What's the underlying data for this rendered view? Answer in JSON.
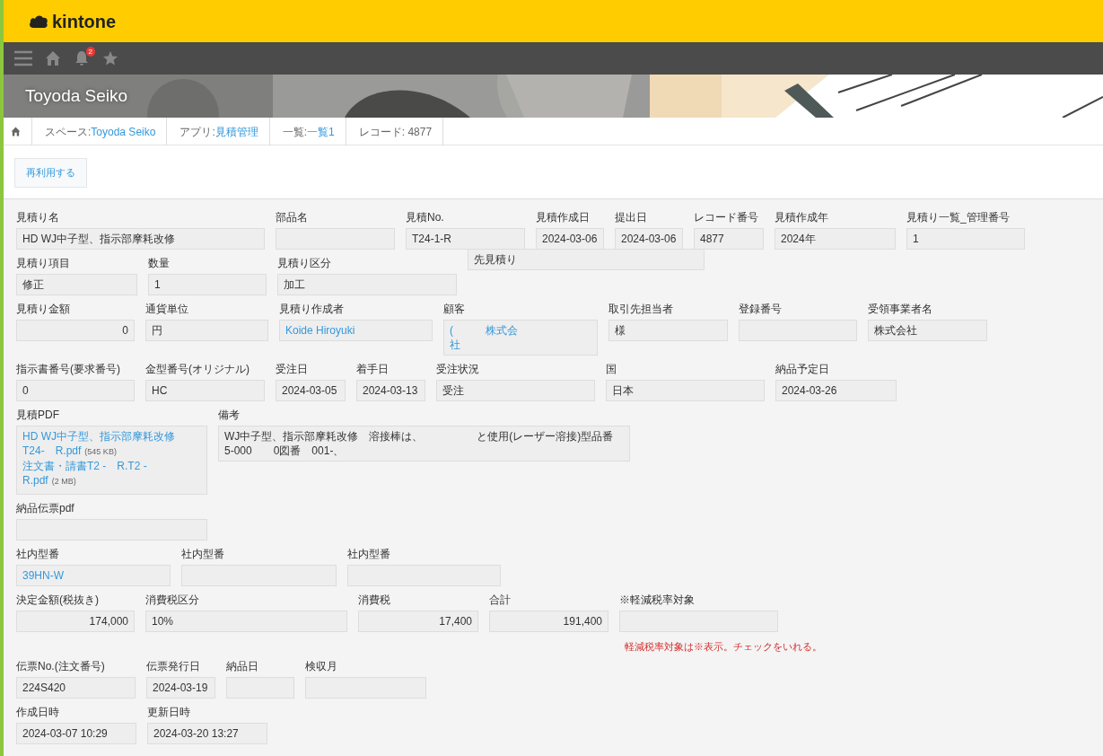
{
  "header": {
    "logo": "kintone"
  },
  "toolbar": {
    "notification_count": "2"
  },
  "banner": {
    "title": "Toyoda Seiko"
  },
  "breadcrumb": [
    {
      "prefix": "スペース: ",
      "link": "Toyoda Seiko"
    },
    {
      "prefix": "アプリ: ",
      "link": "見積管理"
    },
    {
      "prefix": "一覧: ",
      "link": "一覧1"
    },
    {
      "prefix": "レコード: 4877"
    }
  ],
  "actions": [
    {
      "label": "再利用する"
    }
  ],
  "form_rows": [
    {
      "fields": [
        {
          "label": "見積り名",
          "kind": "text",
          "value": "HD WJ中子型、指示部摩耗改修"
        },
        {
          "label": "部品名",
          "kind": "text"
        },
        {
          "label": "見積No.",
          "kind": "text",
          "value": "T24-1-R"
        },
        {
          "label": "見積作成日",
          "kind": "text",
          "value": "2024-03-06"
        },
        {
          "label": "提出日",
          "kind": "text",
          "value": "2024-03-06"
        },
        {
          "label": "レコード番号",
          "kind": "text",
          "value": "4877"
        },
        {
          "label": "見積作成年",
          "kind": "text",
          "value": "2024年"
        },
        {
          "label": "見積り一覧_管理番号",
          "kind": "text",
          "value": "1"
        }
      ]
    },
    {
      "fields": [
        {
          "label": "見積り項目",
          "kind": "text",
          "value": "修正"
        },
        {
          "label": "数量",
          "kind": "text",
          "value": "1"
        },
        {
          "label": "見積り区分",
          "kind": "text",
          "value": "加工"
        },
        {
          "kind": "text",
          "value": "先見積り"
        }
      ]
    },
    {
      "fields": [
        {
          "label": "見積り金額",
          "kind": "number",
          "value": "0"
        },
        {
          "label": "通貨単位",
          "kind": "text",
          "value": "円"
        },
        {
          "label": "見積り作成者",
          "kind": "link",
          "value": "Koide Hiroyuki"
        },
        {
          "label": "顧客",
          "kind": "link",
          "lines": [
            "(　　　株式会",
            "社"
          ]
        },
        {
          "label": "取引先担当者",
          "kind": "text",
          "value": "様"
        },
        {
          "label": "登録番号",
          "kind": "text"
        },
        {
          "label": "受領事業者名",
          "kind": "text",
          "value": "株式会社"
        }
      ]
    },
    {
      "fields": [
        {
          "label": "指示書番号(要求番号)",
          "kind": "text",
          "value": "0"
        },
        {
          "label": "金型番号(オリジナル)",
          "kind": "text",
          "value": "HC"
        },
        {
          "label": "受注日",
          "kind": "text",
          "value": "2024-03-05"
        },
        {
          "label": "着手日",
          "kind": "text",
          "value": "2024-03-13"
        },
        {
          "label": "受注状況",
          "kind": "text",
          "value": "受注"
        },
        {
          "label": "国",
          "kind": "text",
          "value": "日本"
        },
        {
          "label": "納品予定日",
          "kind": "text",
          "value": "2024-03-26"
        }
      ]
    },
    {
      "fields": [
        {
          "label": "見積PDF",
          "kind": "files",
          "files": [
            {
              "name_lines": [
                "HD WJ中子型、指示部摩耗改修",
                "T24-　R.pdf"
              ],
              "size": "(545 KB)"
            },
            {
              "name_lines": [
                "注文書・請書T2 -　R.T2 -",
                "R.pdf"
              ],
              "size": "(2 MB)"
            }
          ]
        },
        {
          "label": "備考",
          "kind": "multiline",
          "value": "WJ中子型、指示部摩耗改修　溶接棒は、　　　　　と使用(レーザー溶接)型品番\n5-000　　0図番　001-、"
        }
      ]
    },
    {
      "fields": [
        {
          "label": "納品伝票pdf",
          "kind": "files"
        }
      ]
    },
    {
      "fields": [
        {
          "label": "社内型番",
          "kind": "link",
          "value": "39HN-W"
        },
        {
          "label": "社内型番",
          "kind": "link"
        },
        {
          "label": "社内型番",
          "kind": "link"
        }
      ]
    },
    {
      "fields": [
        {
          "label": "決定金額(税抜き)",
          "kind": "number",
          "value": "174,000"
        },
        {
          "label": "消費税区分",
          "kind": "text",
          "value": "10%"
        },
        {
          "label": "消費税",
          "kind": "number",
          "value": "17,400"
        },
        {
          "label": "合計",
          "kind": "number",
          "value": "191,400"
        },
        {
          "label": "※軽減税率対象",
          "kind": "text",
          "note": "軽減税率対象は※表示。チェックをいれる。"
        }
      ]
    },
    {
      "fields": [
        {
          "label": "伝票No.(注文番号)",
          "kind": "text",
          "value": "224S420"
        },
        {
          "label": "伝票発行日",
          "kind": "text",
          "value": "2024-03-19"
        },
        {
          "label": "納品日",
          "kind": "text"
        },
        {
          "label": "検収月",
          "kind": "text"
        }
      ]
    },
    {
      "fields": [
        {
          "label": "作成日時",
          "kind": "text",
          "value": "2024-03-07 10:29"
        },
        {
          "label": "更新日時",
          "kind": "text",
          "value": "2024-03-20 13:27"
        }
      ]
    }
  ]
}
